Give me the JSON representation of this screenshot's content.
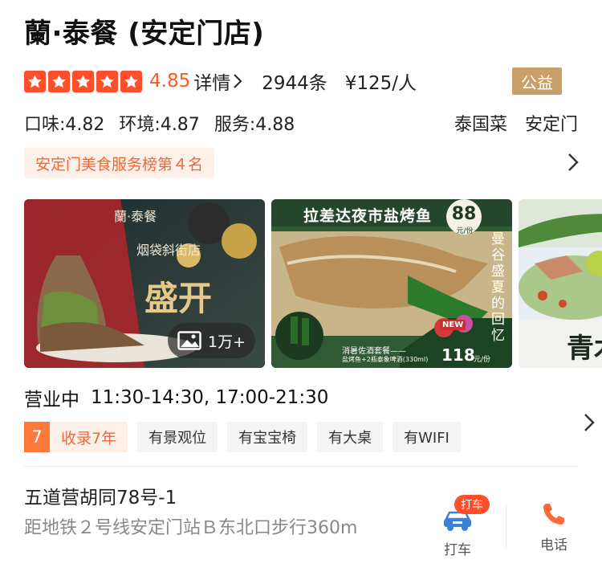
{
  "header": {
    "title": "蘭·泰餐 (安定门店)"
  },
  "rating": {
    "stars": 5,
    "score": "4.85",
    "detail_label": "详情",
    "reviews": "2944条",
    "price": "¥125/人",
    "badge": "公益"
  },
  "scores": {
    "taste": "口味:4.82",
    "environment": "环境:4.87",
    "service": "服务:4.88",
    "cuisine": "泰国菜",
    "area": "安定门"
  },
  "ranking": {
    "label": "安定门美食服务榜第４名"
  },
  "photos": {
    "p1": {
      "brand": "蘭·泰餐",
      "subtitle": "烟袋斜街店",
      "banner": "盛开"
    },
    "p2": {
      "title": "拉差达夜市盐烤鱼",
      "price_tag": "88",
      "price_unit": "元/份",
      "slogan": "曼谷盛夏的回忆",
      "combo_label": "消暑佐酒套餐——",
      "combo_desc": "盐烤鱼+2瓶泰象啤酒(330ml)",
      "combo_price": "118",
      "combo_unit": "元/份",
      "new_badge": "NEW"
    },
    "p3": {
      "partial_text": "青木"
    },
    "count": "1万+"
  },
  "hours": {
    "status": "营业中",
    "times": "11:30-14:30, 17:00-21:30"
  },
  "features": {
    "years_num": "7",
    "years_label": "收录7年",
    "tags": [
      "有景观位",
      "有宝宝椅",
      "有大桌",
      "有WIFI"
    ]
  },
  "location": {
    "address": "五道营胡同78号-1",
    "distance": "距地铁２号线安定门站Ｂ东北口步行360m"
  },
  "actions": {
    "taxi_badge": "打车",
    "taxi_label": "打车",
    "phone_label": "电话"
  },
  "colors": {
    "accent": "#ff4e2b",
    "score": "#ff5a1f",
    "gold": "#c9a06a",
    "tag_orange": "#e96a3b"
  }
}
